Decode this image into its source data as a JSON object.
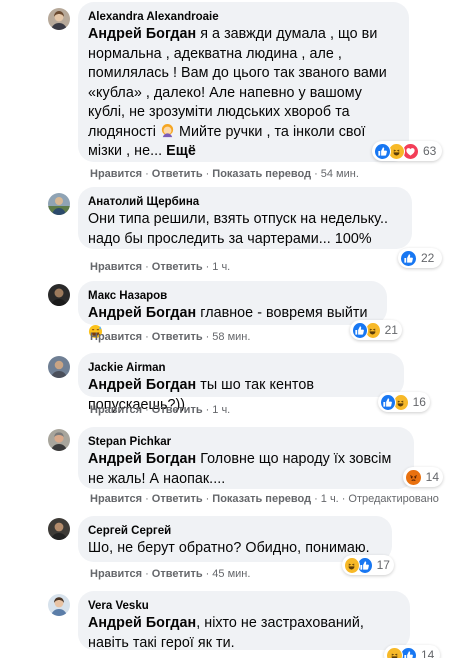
{
  "comments": [
    {
      "author": "Alexandra Alexandroaie",
      "mention": "Андрей Богдан",
      "text": " я а завжди думала , що ви нормальна , адекватна людина , але , помилялась ! Вам до цього так званого вами «кубла» , далеко! Але напевно у вашому кублі, не зрозуміти людських хвороб та людяності ",
      "text_after": " Мийте ручки , та інколи свої мізки , не...",
      "more": " Ещё",
      "actions": [
        "Нравится",
        "Ответить",
        "Показать перевод",
        "54 мин."
      ],
      "reactions": [
        "like",
        "haha",
        "love"
      ],
      "count": "63"
    },
    {
      "author": "Анатолий Щербина",
      "text": "Они типа решили, взять отпуск на недельку.. надо бы проследить за чартерами... 100%",
      "actions": [
        "Нравится",
        "Ответить",
        "1 ч."
      ],
      "reactions": [
        "like"
      ],
      "count": "22"
    },
    {
      "author": "Макс Назаров",
      "mention": "Андрей Богдан",
      "text": " главное - вовремя выйти",
      "actions": [
        "Нравится",
        "Ответить",
        "58 мин."
      ],
      "reactions": [
        "like",
        "haha"
      ],
      "count": "21"
    },
    {
      "author": "Jackie Airman",
      "mention": "Андрей Богдан",
      "text": " ты шо так кентов попускаешь?))",
      "actions": [
        "Нравится",
        "Ответить",
        "1 ч."
      ],
      "reactions": [
        "like",
        "haha"
      ],
      "count": "16"
    },
    {
      "author": "Stepan Pichkar",
      "mention": "Андрей Богдан",
      "text": " Головне що народу їх зовсім не жаль! А наопак....",
      "actions": [
        "Нравится",
        "Ответить",
        "Показать перевод",
        "1 ч.",
        "Отредактировано"
      ],
      "reactions": [
        "angry"
      ],
      "count": "14"
    },
    {
      "author": "Сергей Сергей",
      "text": "Шо, не берут обратно? Обидно, понимаю.",
      "actions": [
        "Нравится",
        "Ответить",
        "45 мин."
      ],
      "reactions": [
        "haha",
        "like"
      ],
      "count": "17"
    },
    {
      "author": "Vera Vesku",
      "mention": "Андрей Богдан",
      "text": ", ніхто не застрахований, навіть такі герої як ти.",
      "reactions": [
        "haha",
        "like"
      ],
      "count": "14"
    }
  ],
  "colors": {
    "like": "#1877f2",
    "haha": "#f7b928",
    "love": "#f33e58",
    "angry": "#e9710f",
    "bubble": "#f0f2f5",
    "meta": "#65676b"
  }
}
